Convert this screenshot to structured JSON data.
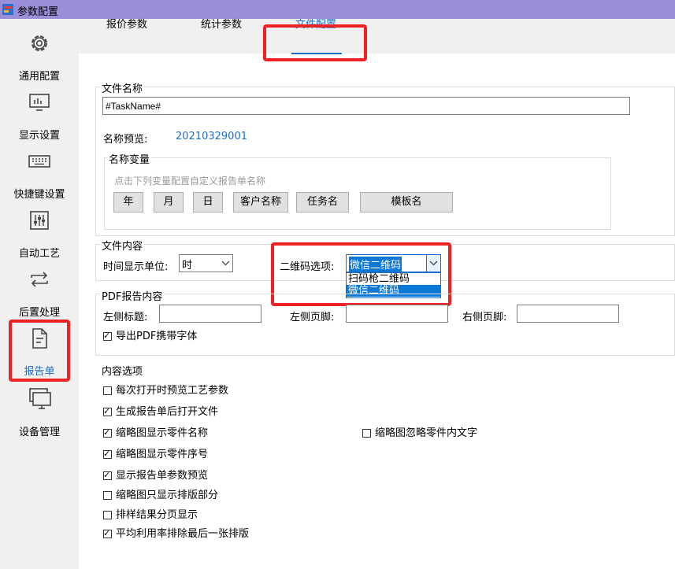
{
  "window": {
    "title": "参数配置"
  },
  "sidebar": {
    "items": [
      {
        "label": "通用配置",
        "icon": "gear-icon"
      },
      {
        "label": "显示设置",
        "icon": "monitor-icon"
      },
      {
        "label": "快捷键设置",
        "icon": "keyboard-icon"
      },
      {
        "label": "自动工艺",
        "icon": "sliders-icon"
      },
      {
        "label": "后置处理",
        "icon": "repeat-icon"
      },
      {
        "label": "报告单",
        "icon": "document-icon",
        "active": true
      },
      {
        "label": "设备管理",
        "icon": "devices-icon"
      }
    ]
  },
  "tabs": [
    {
      "label": "报价参数"
    },
    {
      "label": "统计参数"
    },
    {
      "label": "文件配置",
      "active": true
    }
  ],
  "file_name": {
    "section_label": "文件名称",
    "value": "#TaskName#",
    "preview_label": "名称预览:",
    "preview_value": "20210329001",
    "variables": {
      "label": "名称变量",
      "hint": "点击下列变量配置自定义报告单名称",
      "buttons": [
        "年",
        "月",
        "日",
        "客户名称",
        "任务名",
        "模板名"
      ]
    }
  },
  "file_content": {
    "section_label": "文件内容",
    "time_unit_label": "时间显示单位:",
    "time_unit_value": "时",
    "qr_label": "二维码选项:",
    "qr_value": "微信二维码",
    "qr_options": [
      "扫码枪二维码",
      "微信二维码"
    ]
  },
  "pdf": {
    "section_label": "PDF报告内容",
    "left_title_label": "左侧标题:",
    "left_footer_label": "左侧页脚:",
    "right_footer_label": "右侧页脚:",
    "embed_fonts": {
      "label": "导出PDF携带字体",
      "checked": true
    }
  },
  "content_options": {
    "section_label": "内容选项",
    "items": [
      {
        "label": "每次打开时预览工艺参数",
        "checked": false
      },
      {
        "label": "生成报告单后打开文件",
        "checked": true
      },
      {
        "label": "缩略图显示零件名称",
        "checked": true
      },
      {
        "label": "缩略图忽略零件内文字",
        "checked": false
      },
      {
        "label": "缩略图显示零件序号",
        "checked": true
      },
      {
        "label": "显示报告单参数预览",
        "checked": true
      },
      {
        "label": "缩略图只显示排版部分",
        "checked": false
      },
      {
        "label": "排样结果分页显示",
        "checked": false
      },
      {
        "label": "平均利用率排除最后一张排版",
        "checked": true
      }
    ]
  },
  "colors": {
    "accent": "#1a6fc7",
    "highlight": "#ee2222",
    "titlebar": "#9a8fd8"
  }
}
